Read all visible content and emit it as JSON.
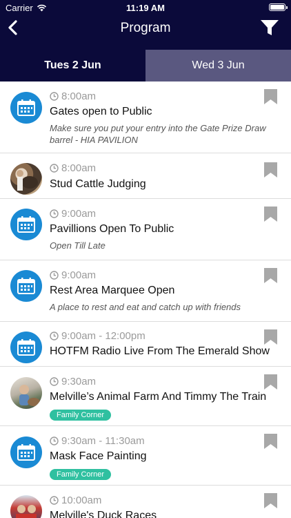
{
  "status_bar": {
    "carrier": "Carrier",
    "time": "11:19 AM"
  },
  "nav": {
    "title": "Program",
    "back_icon": "chevron-left-icon",
    "filter_icon": "filter-icon"
  },
  "tabs": [
    {
      "label": "Tues 2 Jun",
      "active": true
    },
    {
      "label": "Wed 3 Jun",
      "active": false
    }
  ],
  "colors": {
    "navy": "#0b0a3a",
    "inactive_tab": "#5a5880",
    "calendar_blue": "#1a8ad4",
    "tag_green": "#2fc0a0"
  },
  "events": [
    {
      "time": "8:00am",
      "title": "Gates open to Public",
      "description": "Make sure you put your entry into the Gate Prize Draw barrel - HIA PAVILION",
      "avatar": "calendar"
    },
    {
      "time": "8:00am",
      "title": "Stud Cattle Judging",
      "avatar": "photo"
    },
    {
      "time": "9:00am",
      "title": "Pavillions Open To Public",
      "description": "Open Till Late",
      "avatar": "calendar"
    },
    {
      "time": "9:00am",
      "title": "Rest Area Marquee Open",
      "description": "A place to rest and eat and catch up with friends",
      "avatar": "calendar"
    },
    {
      "time": "9:00am - 12:00pm",
      "title": "HOTFM Radio Live From The Emerald Show",
      "avatar": "calendar"
    },
    {
      "time": "9:30am",
      "title": "Melville’s Animal Farm And Timmy The Train",
      "tag": "Family Corner",
      "avatar": "photo"
    },
    {
      "time": "9:30am - 11:30am",
      "title": "Mask Face Painting",
      "tag": "Family Corner",
      "avatar": "calendar"
    },
    {
      "time": "10:00am",
      "title": "Melville's Duck Races",
      "avatar": "photo"
    }
  ]
}
